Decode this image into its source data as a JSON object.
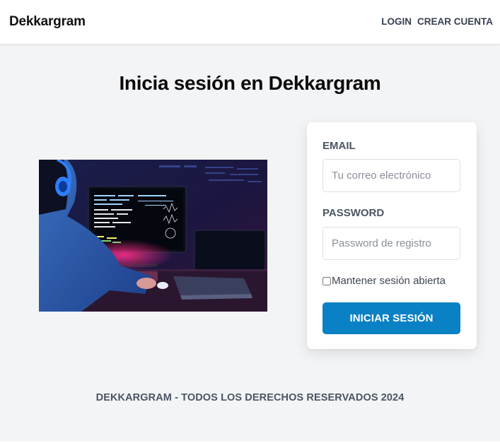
{
  "brand": {
    "name": "Dekkargram"
  },
  "nav": {
    "login": "LOGIN",
    "signup": "CREAR CUENTA"
  },
  "page": {
    "title": "Inicia sesión en Dekkargram"
  },
  "form": {
    "email_label": "EMAIL",
    "email_placeholder": "Tu correo electrónico",
    "password_label": "PASSWORD",
    "password_placeholder": "Password de registro",
    "remember_label": "Mantener sesión abierta",
    "remember_checked": false,
    "submit_label": "INICIAR SESIÓN"
  },
  "footer": {
    "text": "DEKKARGRAM - TODOS LOS DERECHOS RESERVADOS 2024"
  },
  "colors": {
    "primary_button": "#0a81c4",
    "background": "#f3f4f6",
    "label_gray": "#4b5563"
  }
}
